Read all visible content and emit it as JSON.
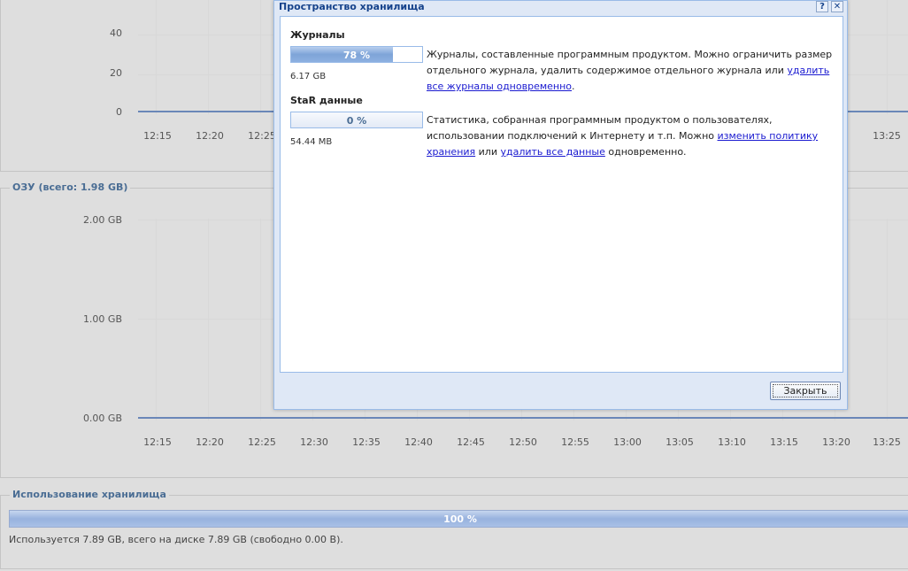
{
  "chart1": {
    "y_ticks": [
      "40",
      "20",
      "0"
    ],
    "x_ticks": [
      "12:15",
      "12:20",
      "12:25",
      "13:25"
    ]
  },
  "ram_panel": {
    "legend": "ОЗУ (всего: 1.98 GB)",
    "y_ticks": [
      "2.00 GB",
      "1.00 GB",
      "0.00 GB"
    ],
    "x_ticks": [
      "12:15",
      "12:20",
      "12:25",
      "12:30",
      "12:35",
      "12:40",
      "12:45",
      "12:50",
      "12:55",
      "13:00",
      "13:05",
      "13:10",
      "13:15",
      "13:20",
      "13:25"
    ]
  },
  "storage_panel": {
    "legend": "Использование хранилища",
    "percent": "100 %",
    "info": "Используется 7.89 GB, всего на диске 7.89 GB (свободно 0.00 B)."
  },
  "dialog": {
    "title": "Пространство хранилища",
    "help_icon": "?",
    "close_icon": "✕",
    "logs": {
      "title": "Журналы",
      "percent_label": "78 %",
      "percent_value": 78,
      "size": "6.17 GB",
      "desc_text": "Журналы, составленные программным продуктом. Можно ограничить размер отдельного журнала, удалить содержимое отдельного журнала или ",
      "desc_link": "удалить все журналы одновременно",
      "desc_end": "."
    },
    "star": {
      "title": "StaR данные",
      "percent_label": "0 %",
      "percent_value": 0,
      "size": "54.44 MB",
      "desc_text1": "Статистика, собранная программным продуктом о пользователях, использовании подключений к Интернету и т.п. Можно ",
      "link1": "изменить политику хранения",
      "desc_text2": " или ",
      "link2": "удалить все данные",
      "desc_text3": " одновременно."
    },
    "close_label": "Закрыть"
  },
  "colors": {
    "accent": "#4a6d94",
    "series_line": "#6a87b8",
    "dialog_bg": "#dfe8f6",
    "link": "#1a1ad0"
  }
}
